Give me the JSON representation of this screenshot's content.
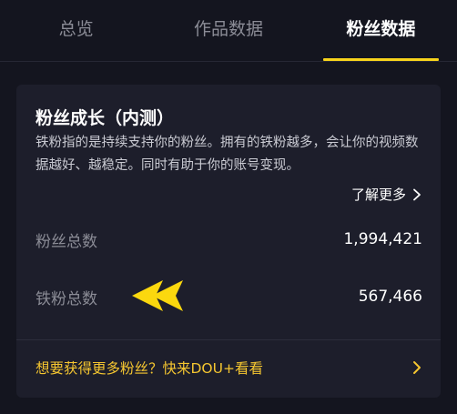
{
  "tabs": [
    {
      "label": "总览",
      "active": false
    },
    {
      "label": "作品数据",
      "active": false
    },
    {
      "label": "粉丝数据",
      "active": true
    }
  ],
  "card": {
    "title": "粉丝成长（内测）",
    "description": "铁粉指的是持续支持你的粉丝。拥有的铁粉越多，会让你的视频数据越好、越稳定。同时有助于你的账号变现。",
    "learn_more": "了解更多",
    "stats": [
      {
        "label": "粉丝总数",
        "value": "1,994,421"
      },
      {
        "label": "铁粉总数",
        "value": "567,466"
      }
    ],
    "promo": "想要获得更多粉丝？快来DOU+看看"
  },
  "colors": {
    "accent": "#f7d31c",
    "promo": "#f5c630",
    "background": "#14151f",
    "card": "#1d1e2b"
  },
  "icons": {
    "learn_more": "chevron-right-icon",
    "promo": "chevron-right-icon",
    "annotation": "yellow-arrow-left-icon"
  }
}
